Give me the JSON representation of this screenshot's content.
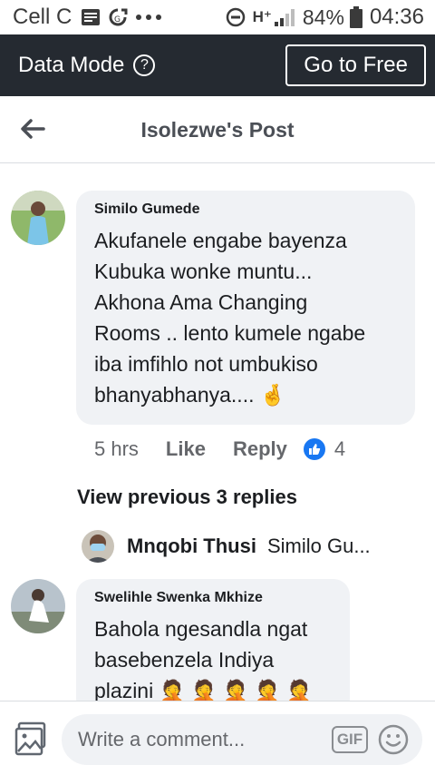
{
  "status_bar": {
    "carrier": "Cell C",
    "network": "H⁺",
    "battery_percent": "84%",
    "time": "04:36"
  },
  "data_mode": {
    "title": "Data Mode",
    "help_glyph": "?",
    "button_label": "Go to Free"
  },
  "header": {
    "title": "Isolezwe's Post"
  },
  "comments": [
    {
      "author": "Similo Gumede",
      "text_lines": [
        "Akufanele engabe bayenza",
        "Kubuka wonke muntu...",
        "Akhona Ama Changing",
        "Rooms .. lento kumele ngabe",
        "iba imfihlo not umbukiso",
        "bhanyabhanya.... 🤞"
      ],
      "time": "5 hrs",
      "like_label": "Like",
      "reply_label": "Reply",
      "reaction_count": "4"
    },
    {
      "author": "Swelihle Swenka Mkhize",
      "text_lines": [
        "Bahola ngesandla ngat",
        "basebenzela Indiya",
        "plazini 🤦 🤦 🤦 🤦 🤦"
      ]
    }
  ],
  "view_previous": "View previous 3 replies",
  "reply_preview": {
    "name": "Mnqobi Thusi",
    "snippet": "Similo Gu..."
  },
  "composer": {
    "placeholder": "Write a comment...",
    "gif_label": "GIF"
  },
  "colors": {
    "data_bar_bg": "#252a31",
    "bubble_bg": "#f0f2f5",
    "like_blue": "#1877f2"
  }
}
